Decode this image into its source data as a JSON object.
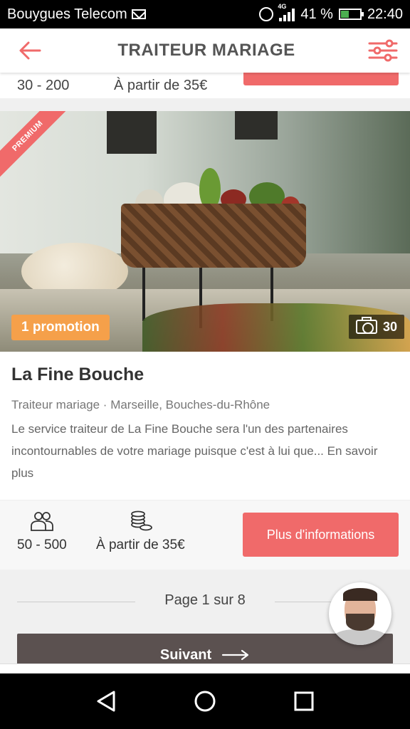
{
  "status_bar": {
    "carrier": "Bouygues Telecom",
    "network": "4G",
    "battery": "41 %",
    "time": "22:40"
  },
  "header": {
    "title": "TRAITEUR MARIAGE",
    "back_icon": "arrow-left-icon",
    "filter_icon": "filter-sliders-icon"
  },
  "previous_card": {
    "capacity": "30 - 200",
    "price": "À partir de 35€"
  },
  "card": {
    "ribbon": "PREMIUM",
    "promotion": "1 promotion",
    "photo_count": "30",
    "title": "La Fine Bouche",
    "meta": "Traiteur mariage · Marseille, Bouches-du-Rhône",
    "description": "Le service traiteur de La Fine Bouche sera l'un des partenaires incontournables de votre mariage puisque c'est à lui que... En savoir plus",
    "capacity": "50 - 500",
    "price": "À partir de 35€",
    "cta": "Plus d'informations"
  },
  "pagination": {
    "label": "Page 1 sur 8",
    "next": "Suivant"
  },
  "colors": {
    "accent": "#f06a6a",
    "promo": "#f5a04a",
    "next_button": "#5b5150"
  }
}
